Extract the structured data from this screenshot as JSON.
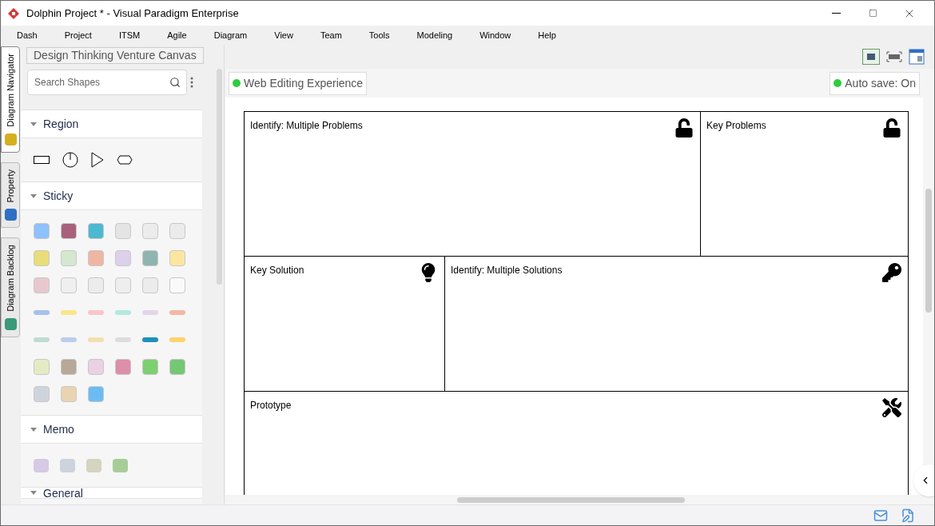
{
  "window": {
    "title": "Dolphin Project * - Visual Paradigm Enterprise"
  },
  "menu": [
    "Dash",
    "Project",
    "ITSM",
    "Agile",
    "Diagram",
    "View",
    "Team",
    "Tools",
    "Modeling",
    "Window",
    "Help"
  ],
  "side_tabs": [
    {
      "label": "Diagram Navigator",
      "selected": true
    },
    {
      "label": "Property",
      "selected": false
    },
    {
      "label": "Diagram Backlog",
      "selected": false
    }
  ],
  "breadcrumb": "Design Thinking Venture Canvas",
  "search": {
    "placeholder": "Search Shapes"
  },
  "sections": [
    {
      "title": "Region",
      "kind": "region"
    },
    {
      "title": "Sticky",
      "kind": "sticky"
    },
    {
      "title": "Memo",
      "kind": "memo"
    },
    {
      "title": "General",
      "kind": "none"
    }
  ],
  "badges": [
    {
      "label": "Web Editing Experience",
      "color": "#2ecc40"
    },
    {
      "label": "Auto save: On",
      "color": "#2ecc40"
    }
  ],
  "canvas_rows": [
    {
      "cells": [
        {
          "label": "Identify: Multiple Problems",
          "kind": "unlock"
        },
        {
          "label": "Key Problems",
          "kind": "unlock"
        }
      ]
    },
    {
      "cells": [
        {
          "label": "Key Solution",
          "kind": "bulb"
        },
        {
          "label": "Identify: Multiple Solutions",
          "kind": "key"
        }
      ]
    },
    {
      "cells": [
        {
          "label": "Prototype",
          "kind": "tools"
        }
      ]
    }
  ]
}
